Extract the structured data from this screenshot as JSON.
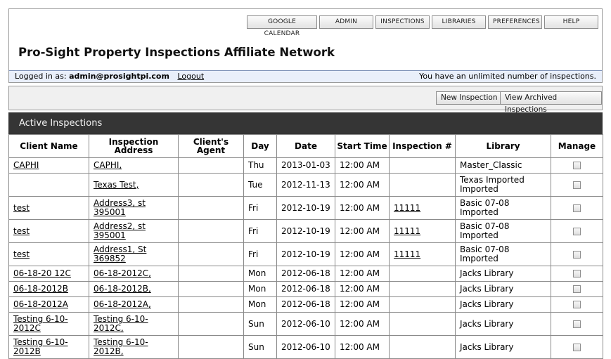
{
  "nav": {
    "buttons": [
      "GOOGLE CALENDAR",
      "ADMIN",
      "INSPECTIONS",
      "LIBRARIES",
      "PREFERENCES",
      "HELP"
    ]
  },
  "site_title": "Pro-Sight Property Inspections Affiliate Network",
  "userbar": {
    "logged_in_label": "Logged in as:",
    "user": "admin@prosightpi.com",
    "logout": "Logout",
    "quota": "You have an unlimited number of inspections."
  },
  "actions": {
    "new_inspection": "New Inspection",
    "view_archived": "View Archived Inspections"
  },
  "panel_title": "Active Inspections",
  "table": {
    "headers": [
      "Client Name",
      "Inspection Address",
      "Client's Agent",
      "Day",
      "Date",
      "Start Time",
      "Inspection #",
      "Library",
      "Manage"
    ],
    "rows": [
      {
        "client": "CAPHI",
        "address": "CAPHI,",
        "agent": "",
        "day": "Thu",
        "date": "2013-01-03",
        "time": "12:00 AM",
        "num": "",
        "library": "Master_Classic"
      },
      {
        "client": "",
        "address": "Texas Test,",
        "agent": "",
        "day": "Tue",
        "date": "2012-11-13",
        "time": "12:00 AM",
        "num": "",
        "library": "Texas Imported Imported"
      },
      {
        "client": "test",
        "address": "Address3, st 395001",
        "agent": "",
        "day": "Fri",
        "date": "2012-10-19",
        "time": "12:00 AM",
        "num": "11111",
        "library": "Basic 07-08 Imported"
      },
      {
        "client": "test",
        "address": "Address2, st 395001",
        "agent": "",
        "day": "Fri",
        "date": "2012-10-19",
        "time": "12:00 AM",
        "num": "11111",
        "library": "Basic 07-08 Imported"
      },
      {
        "client": "test",
        "address": "Address1, St 369852",
        "agent": "",
        "day": "Fri",
        "date": "2012-10-19",
        "time": "12:00 AM",
        "num": "11111",
        "library": "Basic 07-08 Imported"
      },
      {
        "client": "06-18-20 12C",
        "address": "06-18-2012C,",
        "agent": "",
        "day": "Mon",
        "date": "2012-06-18",
        "time": "12:00 AM",
        "num": "",
        "library": "Jacks Library"
      },
      {
        "client": "06-18-2012B",
        "address": "06-18-2012B,",
        "agent": "",
        "day": "Mon",
        "date": "2012-06-18",
        "time": "12:00 AM",
        "num": "",
        "library": "Jacks Library"
      },
      {
        "client": "06-18-2012A",
        "address": "06-18-2012A,",
        "agent": "",
        "day": "Mon",
        "date": "2012-06-18",
        "time": "12:00 AM",
        "num": "",
        "library": "Jacks Library"
      },
      {
        "client": "Testing 6-10-2012C",
        "address": "Testing 6-10-2012C,",
        "agent": "",
        "day": "Sun",
        "date": "2012-06-10",
        "time": "12:00 AM",
        "num": "",
        "library": "Jacks Library"
      },
      {
        "client": "Testing 6-10-2012B",
        "address": "Testing 6-10-2012B,",
        "agent": "",
        "day": "Sun",
        "date": "2012-06-10",
        "time": "12:00 AM",
        "num": "",
        "library": "Jacks Library"
      }
    ]
  }
}
